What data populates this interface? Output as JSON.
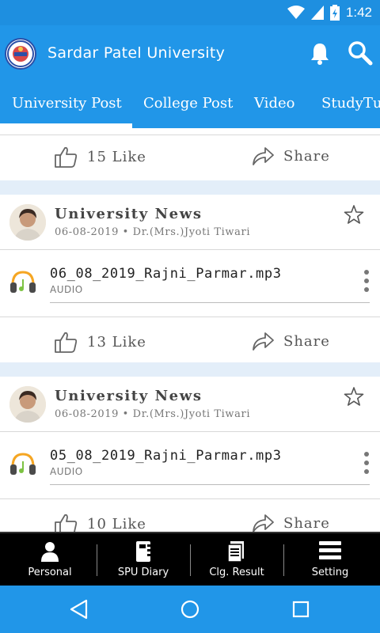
{
  "status_bar": {
    "time": "1:42",
    "icons": [
      "wifi-icon",
      "signal-icon",
      "battery-charging-icon"
    ]
  },
  "app_bar": {
    "title": "Sardar Patel University",
    "logo": "university-logo",
    "actions": [
      "bell-icon",
      "search-icon"
    ]
  },
  "tabs": [
    {
      "label": "University Post",
      "active": true
    },
    {
      "label": "College Post",
      "active": false
    },
    {
      "label": "Video",
      "active": false
    },
    {
      "label": "StudyTu",
      "active": false
    }
  ],
  "feed": {
    "top_card": {
      "likes": "15 Like",
      "share": "Share"
    },
    "posts": [
      {
        "title": "University News",
        "meta": "06-08-2019 • Dr.(Mrs.)Jyoti Tiwari",
        "attachment": {
          "name": "06_08_2019_Rajni_Parmar.mp3",
          "type": "AUDIO"
        },
        "likes": "13 Like",
        "share": "Share"
      },
      {
        "title": "University News",
        "meta": "06-08-2019 • Dr.(Mrs.)Jyoti Tiwari",
        "attachment": {
          "name": "05_08_2019_Rajni_Parmar.mp3",
          "type": "AUDIO"
        },
        "likes": "10 Like",
        "share": "Share"
      }
    ]
  },
  "bottom_nav": [
    {
      "label": "Personal",
      "icon": "person-icon"
    },
    {
      "label": "SPU Diary",
      "icon": "diary-icon"
    },
    {
      "label": "Clg. Result",
      "icon": "result-icon"
    },
    {
      "label": "Setting",
      "icon": "menu-icon"
    }
  ],
  "colors": {
    "primary": "#2196e8",
    "status_bar": "#1e8fe0",
    "feed_bg": "#e3eef9",
    "nav_bg": "#000000"
  }
}
